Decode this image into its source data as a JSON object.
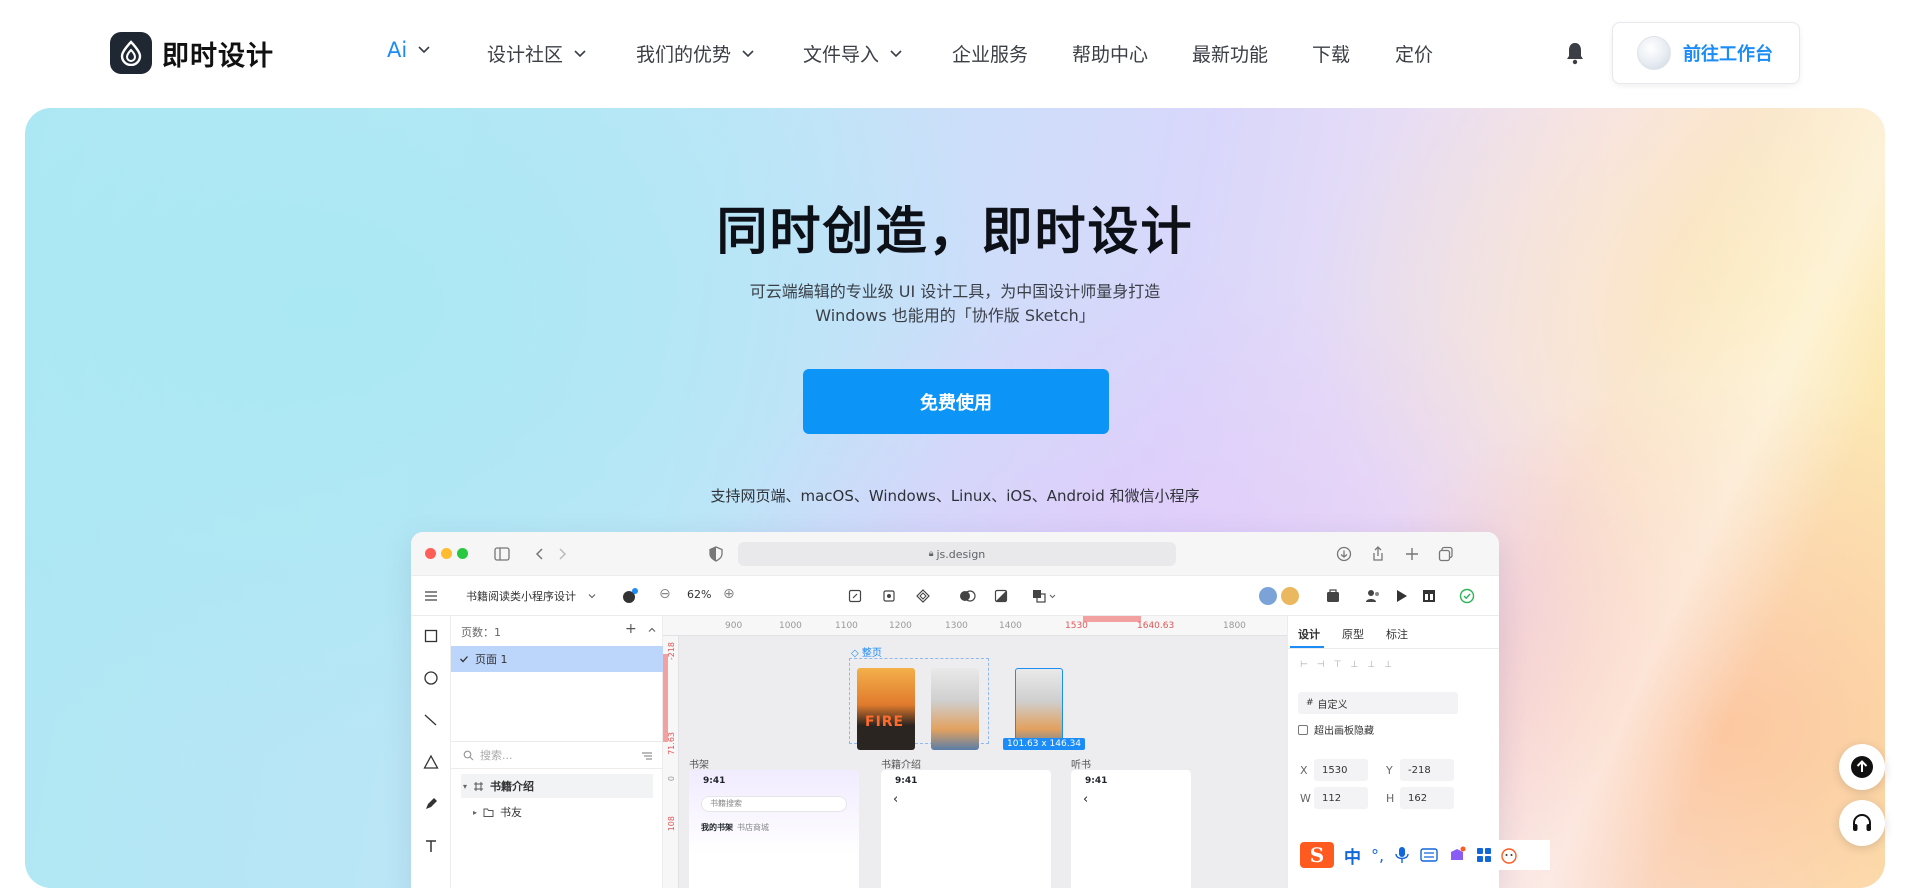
{
  "brand": {
    "name": "即时设计"
  },
  "nav": {
    "items": [
      {
        "label": "Ai",
        "dropdown": true
      },
      {
        "label": "设计社区",
        "dropdown": true
      },
      {
        "label": "我们的优势",
        "dropdown": true
      },
      {
        "label": "文件导入",
        "dropdown": true
      },
      {
        "label": "企业服务",
        "dropdown": false
      },
      {
        "label": "帮助中心",
        "dropdown": false
      },
      {
        "label": "最新功能",
        "dropdown": false
      },
      {
        "label": "下载",
        "dropdown": false
      },
      {
        "label": "定价",
        "dropdown": false
      }
    ],
    "workspace_label": "前往工作台",
    "bell_icon": "bell-icon"
  },
  "hero": {
    "title": "同时创造，即时设计",
    "subtitle_line1": "可云端编辑的专业级 UI 设计工具，为中国设计师量身打造",
    "subtitle_line2": "Windows 也能用的「协作版 Sketch」",
    "cta_label": "免费使用",
    "platforms": "支持网页端、macOS、Windows、Linux、iOS、Android 和微信小程序"
  },
  "mockup": {
    "url": "js.design",
    "file_name": "书籍阅读类小程序设计",
    "zoom": "62%",
    "pages_label": "页数：1",
    "page_name": "页面 1",
    "search_placeholder": "搜索...",
    "tree": [
      {
        "label": "书籍介绍"
      },
      {
        "label": "书友"
      }
    ],
    "ruler_ticks": [
      "900",
      "1000",
      "1100",
      "1200",
      "1300",
      "1400",
      "1530",
      "1640.63",
      "1800"
    ],
    "ruler_left_ticks": [
      "-218",
      "71.63",
      "0",
      "108"
    ],
    "frame_group_label": "整页",
    "selection_size": "101.63 x 146.34",
    "frame_labels": [
      "书架",
      "书籍介绍",
      "听书"
    ],
    "phone_time": "9:41",
    "phone_search": "书籍搜索",
    "phone_tabs": [
      "我的书架",
      "书店商城"
    ],
    "book_cover_text": "FIRE",
    "right_tabs": [
      "设计",
      "原型",
      "标注"
    ],
    "frame_preset": "自定义",
    "clip_label": "超出画板隐藏",
    "fields": {
      "x_label": "X",
      "x": "1530",
      "y_label": "Y",
      "y": "-218",
      "w_label": "W",
      "w": "112",
      "h_label": "H",
      "h": "162"
    }
  },
  "ime": {
    "logo": "S",
    "mode": "中",
    "punct": "°,"
  },
  "colors": {
    "accent": "#0d94f7",
    "nav_active": "#1c8cf6",
    "title": "#0d1117"
  }
}
